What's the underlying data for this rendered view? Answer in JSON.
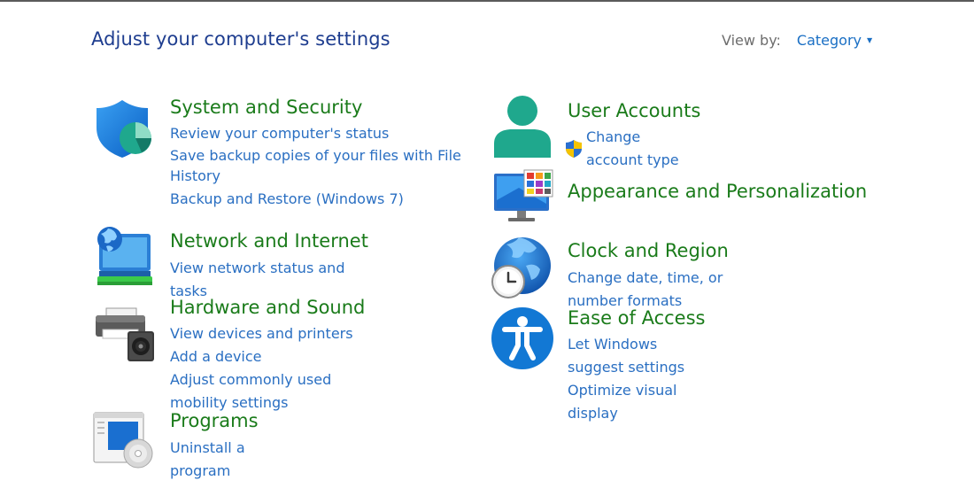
{
  "page_title": "Adjust your computer's settings",
  "view_by": {
    "label": "View by:",
    "value": "Category"
  },
  "categories_left": [
    {
      "id": "system-security",
      "title": "System and Security",
      "icon": "shield-icon",
      "links": [
        "Review your computer's status",
        "Save backup copies of your files with File History",
        "Backup and Restore (Windows 7)"
      ]
    },
    {
      "id": "network-internet",
      "title": "Network and Internet",
      "icon": "network-globe-icon",
      "links": [
        "View network status and tasks"
      ]
    },
    {
      "id": "hardware-sound",
      "title": "Hardware and Sound",
      "icon": "printer-speaker-icon",
      "links": [
        "View devices and printers",
        "Add a device",
        "Adjust commonly used mobility settings"
      ]
    },
    {
      "id": "programs",
      "title": "Programs",
      "icon": "programs-disc-icon",
      "links": [
        "Uninstall a program"
      ]
    }
  ],
  "categories_right": [
    {
      "id": "user-accounts",
      "title": "User Accounts",
      "icon": "user-icon",
      "links": [
        "Change account type"
      ]
    },
    {
      "id": "appearance",
      "title": "Appearance and Personalization",
      "icon": "monitor-palette-icon",
      "links": []
    },
    {
      "id": "clock-region",
      "title": "Clock and Region",
      "icon": "globe-clock-icon",
      "links": [
        "Change date, time, or number formats"
      ]
    },
    {
      "id": "ease-access",
      "title": "Ease of Access",
      "icon": "accessibility-icon",
      "links": [
        "Let Windows suggest settings",
        "Optimize visual display"
      ]
    }
  ],
  "colors": {
    "title_blue": "#1e3d8f",
    "category_green": "#1a7b1a",
    "link_blue": "#2a6fc2",
    "muted_gray": "#6d6d6d"
  }
}
